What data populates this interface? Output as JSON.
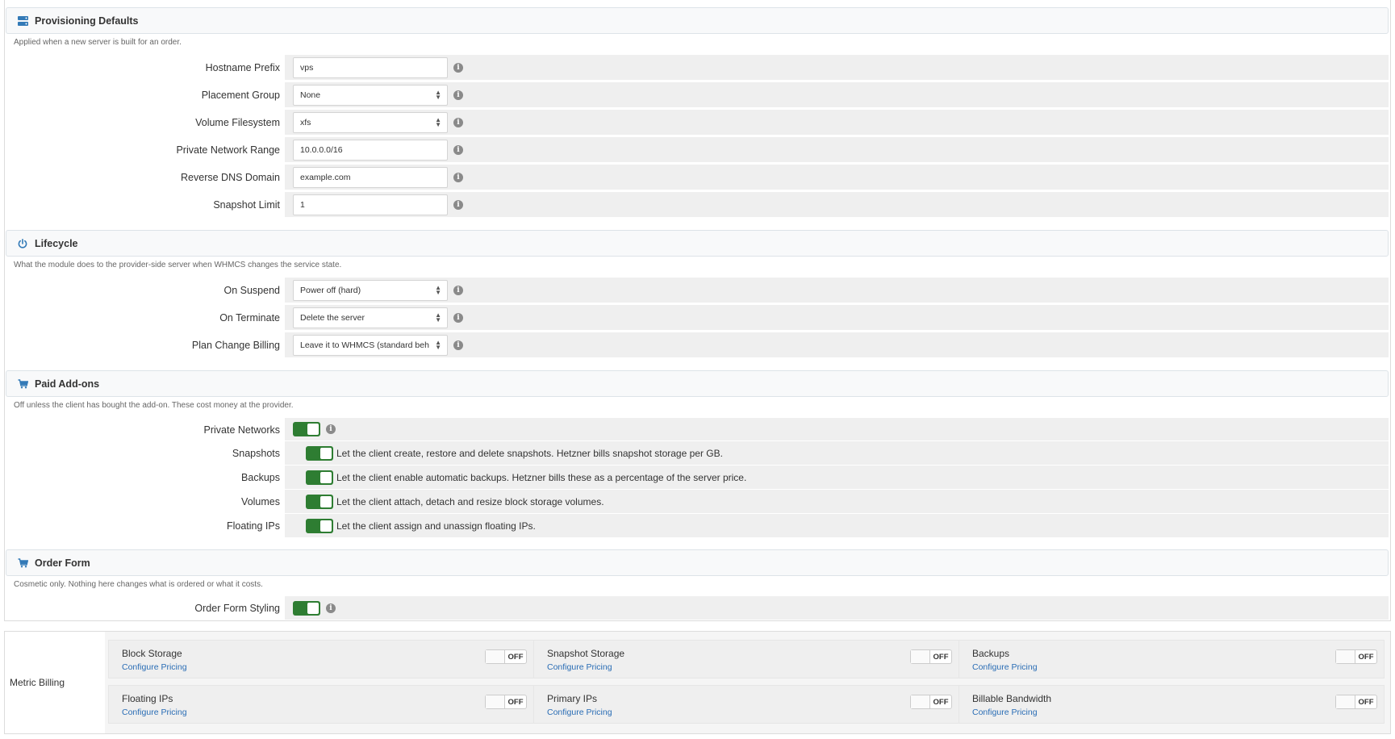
{
  "colors": {
    "accent": "#2e7d32",
    "link": "#2a6db5",
    "icon": "#337ab7"
  },
  "provisioning": {
    "title": "Provisioning Defaults",
    "icon": "server-icon",
    "description": "Applied when a new server is built for an order.",
    "fields": {
      "hostname_prefix": {
        "label": "Hostname Prefix",
        "value": "vps"
      },
      "placement_group": {
        "label": "Placement Group",
        "value": "None"
      },
      "volume_filesystem": {
        "label": "Volume Filesystem",
        "value": "xfs"
      },
      "private_network_range": {
        "label": "Private Network Range",
        "value": "10.0.0.0/16"
      },
      "reverse_dns_domain": {
        "label": "Reverse DNS Domain",
        "value": "example.com"
      },
      "snapshot_limit": {
        "label": "Snapshot Limit",
        "value": "1"
      }
    }
  },
  "lifecycle": {
    "title": "Lifecycle",
    "icon": "power-icon",
    "description": "What the module does to the provider-side server when WHMCS changes the service state.",
    "fields": {
      "on_suspend": {
        "label": "On Suspend",
        "value": "Power off (hard)"
      },
      "on_terminate": {
        "label": "On Terminate",
        "value": "Delete the server"
      },
      "plan_change_billing": {
        "label": "Plan Change Billing",
        "value": "Leave it to WHMCS (standard behaviour)"
      }
    }
  },
  "addons": {
    "title": "Paid Add-ons",
    "icon": "cart-icon",
    "description": "Off unless the client has bought the add-on. These cost money at the provider.",
    "private_networks": {
      "label": "Private Networks",
      "enabled": true
    },
    "snapshots": {
      "label": "Snapshots",
      "enabled": true,
      "desc": "Let the client create, restore and delete snapshots. Hetzner bills snapshot storage per GB."
    },
    "backups": {
      "label": "Backups",
      "enabled": true,
      "desc": "Let the client enable automatic backups. Hetzner bills these as a percentage of the server price."
    },
    "volumes": {
      "label": "Volumes",
      "enabled": true,
      "desc": "Let the client attach, detach and resize block storage volumes."
    },
    "floating_ips": {
      "label": "Floating IPs",
      "enabled": true,
      "desc": "Let the client assign and unassign floating IPs."
    }
  },
  "order_form": {
    "title": "Order Form",
    "icon": "cart-icon",
    "description": "Cosmetic only. Nothing here changes what is ordered or what it costs.",
    "styling": {
      "label": "Order Form Styling",
      "enabled": true
    }
  },
  "metric_billing": {
    "label": "Metric Billing",
    "link_label": "Configure Pricing",
    "toggle_label": "OFF",
    "items": [
      {
        "name": "Block Storage"
      },
      {
        "name": "Snapshot Storage"
      },
      {
        "name": "Backups"
      },
      {
        "name": "Floating IPs"
      },
      {
        "name": "Primary IPs"
      },
      {
        "name": "Billable Bandwidth"
      }
    ]
  }
}
